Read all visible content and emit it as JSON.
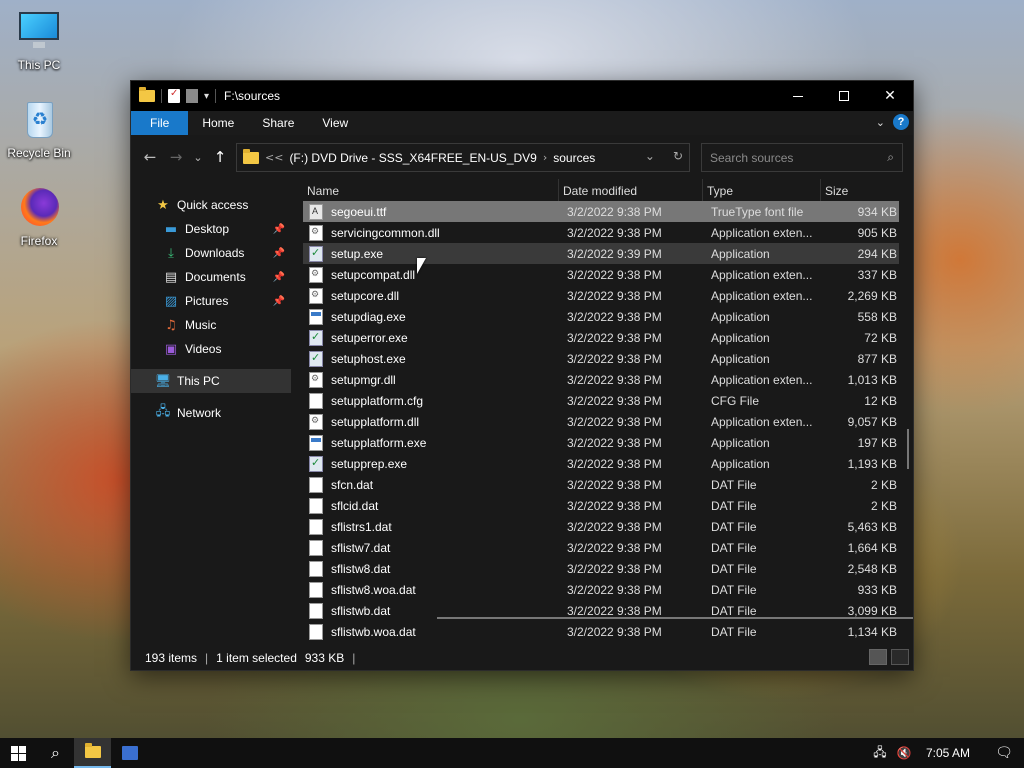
{
  "desktop": {
    "icons": [
      {
        "label": "This PC",
        "icon": "this-pc-icon"
      },
      {
        "label": "Recycle Bin",
        "icon": "recycle-bin-icon"
      },
      {
        "label": "Firefox",
        "icon": "firefox-icon"
      }
    ]
  },
  "window": {
    "title": "F:\\sources",
    "ribbon_tabs": [
      "File",
      "Home",
      "Share",
      "View"
    ],
    "address": {
      "overflow": "<<",
      "segments": [
        "(F:) DVD Drive - SSS_X64FREE_EN-US_DV9",
        "sources"
      ]
    },
    "search": {
      "placeholder": "Search sources"
    },
    "nav": {
      "quick_access": "Quick access",
      "items": [
        {
          "label": "Desktop",
          "icon": "desktop-icon",
          "pinned": true
        },
        {
          "label": "Downloads",
          "icon": "downloads-icon",
          "pinned": true
        },
        {
          "label": "Documents",
          "icon": "documents-icon",
          "pinned": true
        },
        {
          "label": "Pictures",
          "icon": "pictures-icon",
          "pinned": true
        },
        {
          "label": "Music",
          "icon": "music-icon",
          "pinned": false
        },
        {
          "label": "Videos",
          "icon": "videos-icon",
          "pinned": false
        }
      ],
      "this_pc": "This PC",
      "network": "Network"
    },
    "columns": [
      "Name",
      "Date modified",
      "Type",
      "Size"
    ],
    "files": [
      {
        "name": "segoeui.ttf",
        "date": "3/2/2022 9:38 PM",
        "type": "TrueType font file",
        "size": "934 KB",
        "icon": "font"
      },
      {
        "name": "servicingcommon.dll",
        "date": "3/2/2022 9:38 PM",
        "type": "Application exten...",
        "size": "905 KB",
        "icon": "dll"
      },
      {
        "name": "setup.exe",
        "date": "3/2/2022 9:39 PM",
        "type": "Application",
        "size": "294 KB",
        "icon": "setup"
      },
      {
        "name": "setupcompat.dll",
        "date": "3/2/2022 9:38 PM",
        "type": "Application exten...",
        "size": "337 KB",
        "icon": "dll"
      },
      {
        "name": "setupcore.dll",
        "date": "3/2/2022 9:38 PM",
        "type": "Application exten...",
        "size": "2,269 KB",
        "icon": "dll"
      },
      {
        "name": "setupdiag.exe",
        "date": "3/2/2022 9:38 PM",
        "type": "Application",
        "size": "558 KB",
        "icon": "exe"
      },
      {
        "name": "setuperror.exe",
        "date": "3/2/2022 9:38 PM",
        "type": "Application",
        "size": "72 KB",
        "icon": "setup"
      },
      {
        "name": "setuphost.exe",
        "date": "3/2/2022 9:38 PM",
        "type": "Application",
        "size": "877 KB",
        "icon": "setup"
      },
      {
        "name": "setupmgr.dll",
        "date": "3/2/2022 9:38 PM",
        "type": "Application exten...",
        "size": "1,013 KB",
        "icon": "dll"
      },
      {
        "name": "setupplatform.cfg",
        "date": "3/2/2022 9:38 PM",
        "type": "CFG File",
        "size": "12 KB",
        "icon": "doc"
      },
      {
        "name": "setupplatform.dll",
        "date": "3/2/2022 9:38 PM",
        "type": "Application exten...",
        "size": "9,057 KB",
        "icon": "dll"
      },
      {
        "name": "setupplatform.exe",
        "date": "3/2/2022 9:38 PM",
        "type": "Application",
        "size": "197 KB",
        "icon": "exe"
      },
      {
        "name": "setupprep.exe",
        "date": "3/2/2022 9:38 PM",
        "type": "Application",
        "size": "1,193 KB",
        "icon": "setup"
      },
      {
        "name": "sfcn.dat",
        "date": "3/2/2022 9:38 PM",
        "type": "DAT File",
        "size": "2 KB",
        "icon": "doc"
      },
      {
        "name": "sflcid.dat",
        "date": "3/2/2022 9:38 PM",
        "type": "DAT File",
        "size": "2 KB",
        "icon": "doc"
      },
      {
        "name": "sflistrs1.dat",
        "date": "3/2/2022 9:38 PM",
        "type": "DAT File",
        "size": "5,463 KB",
        "icon": "doc"
      },
      {
        "name": "sflistw7.dat",
        "date": "3/2/2022 9:38 PM",
        "type": "DAT File",
        "size": "1,664 KB",
        "icon": "doc"
      },
      {
        "name": "sflistw8.dat",
        "date": "3/2/2022 9:38 PM",
        "type": "DAT File",
        "size": "2,548 KB",
        "icon": "doc"
      },
      {
        "name": "sflistw8.woa.dat",
        "date": "3/2/2022 9:38 PM",
        "type": "DAT File",
        "size": "933 KB",
        "icon": "doc"
      },
      {
        "name": "sflistwb.dat",
        "date": "3/2/2022 9:38 PM",
        "type": "DAT File",
        "size": "3,099 KB",
        "icon": "doc"
      },
      {
        "name": "sflistwb.woa.dat",
        "date": "3/2/2022 9:38 PM",
        "type": "DAT File",
        "size": "1,134 KB",
        "icon": "doc"
      }
    ],
    "status": {
      "count": "193 items",
      "selected": "1 item selected",
      "selected_size": "933 KB"
    }
  },
  "taskbar": {
    "clock": "7:05 AM"
  }
}
